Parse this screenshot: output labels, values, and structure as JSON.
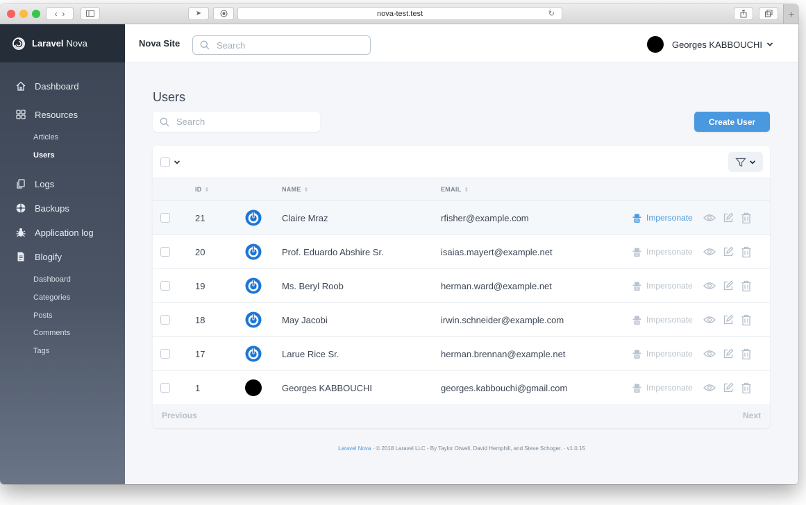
{
  "browser": {
    "url": "nova-test.test"
  },
  "sidebar": {
    "brand_bold": "Laravel",
    "brand_rest": "Nova",
    "items": [
      {
        "label": "Dashboard",
        "icon": "home-icon"
      },
      {
        "label": "Resources",
        "icon": "grid-icon"
      },
      {
        "label": "Logs",
        "icon": "copy-icon"
      },
      {
        "label": "Backups",
        "icon": "globe-icon"
      },
      {
        "label": "Application log",
        "icon": "bug-icon"
      },
      {
        "label": "Blogify",
        "icon": "document-icon"
      }
    ],
    "resources_sub": [
      "Articles",
      "Users"
    ],
    "blogify_sub": [
      "Dashboard",
      "Categories",
      "Posts",
      "Comments",
      "Tags"
    ]
  },
  "header": {
    "site_name": "Nova Site",
    "search_placeholder": "Search",
    "user_name": "Georges KABBOUCHI"
  },
  "main": {
    "title": "Users",
    "search_placeholder": "Search",
    "create_label": "Create User"
  },
  "table": {
    "columns": [
      "ID",
      "NAME",
      "EMAIL"
    ],
    "rows": [
      {
        "id": "21",
        "name": "Claire Mraz",
        "email": "rfisher@example.com",
        "avatar": "power"
      },
      {
        "id": "20",
        "name": "Prof. Eduardo Abshire Sr.",
        "email": "isaias.mayert@example.net",
        "avatar": "power"
      },
      {
        "id": "19",
        "name": "Ms. Beryl Roob",
        "email": "herman.ward@example.net",
        "avatar": "power"
      },
      {
        "id": "18",
        "name": "May Jacobi",
        "email": "irwin.schneider@example.com",
        "avatar": "power"
      },
      {
        "id": "17",
        "name": "Larue Rice Sr.",
        "email": "herman.brennan@example.net",
        "avatar": "power"
      },
      {
        "id": "1",
        "name": "Georges KABBOUCHI",
        "email": "georges.kabbouchi@gmail.com",
        "avatar": "dark"
      }
    ],
    "impersonate_label": "Impersonate",
    "previous_label": "Previous",
    "next_label": "Next"
  },
  "footer": {
    "link": "Laravel Nova",
    "text": "·  © 2018 Laravel LLC - By Taylor Otwell, David Hemphill, and Steve Schoger.  ·  v1.0.15"
  },
  "colors": {
    "accent": "#4a99e0",
    "sidebar": "#3b4453",
    "brand_bar": "#252d38"
  }
}
